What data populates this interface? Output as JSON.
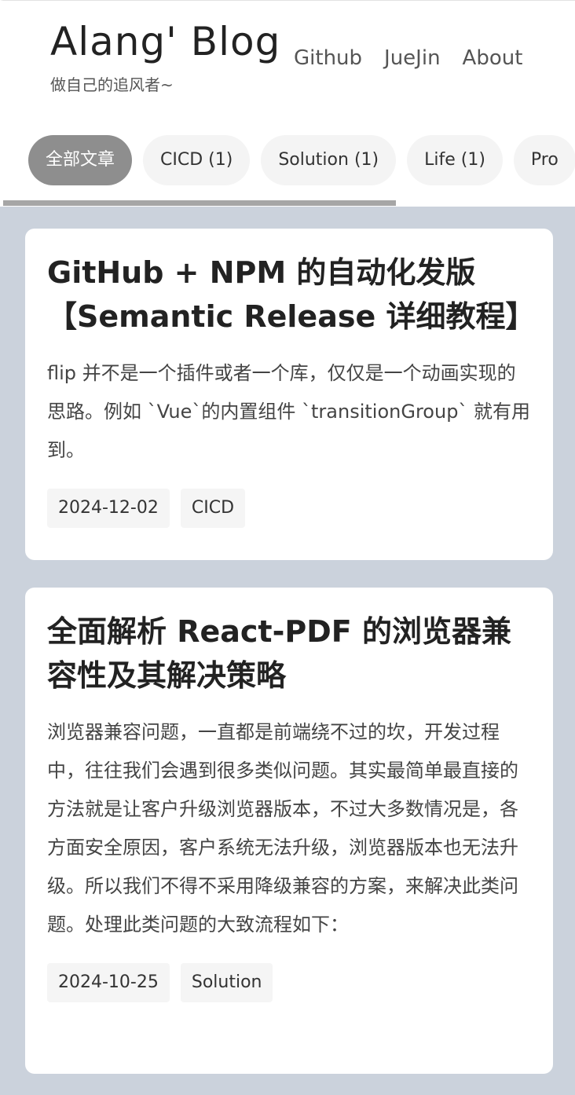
{
  "header": {
    "title": "Alang' Blog",
    "subtitle": "做自己的追风者~",
    "nav": [
      {
        "label": "Github"
      },
      {
        "label": "JueJin"
      },
      {
        "label": "About"
      }
    ]
  },
  "tabs": [
    {
      "label": "全部文章"
    },
    {
      "label": "CICD (1)"
    },
    {
      "label": "Solution (1)"
    },
    {
      "label": "Life (1)"
    },
    {
      "label": "Pro"
    }
  ],
  "posts": [
    {
      "title": "GitHub + NPM 的自动化发版【Semantic Release 详细教程】",
      "excerpt": "flip 并不是一个插件或者一个库，仅仅是一个动画实现的思路。例如 `Vue`的内置组件 `transitionGroup` 就有用到。",
      "date": "2024-12-02",
      "category": "CICD"
    },
    {
      "title": "全面解析 React-PDF 的浏览器兼容性及其解决策略",
      "excerpt": "浏览器兼容问题，一直都是前端绕不过的坎，开发过程中，往往我们会遇到很多类似问题。其实最简单最直接的方法就是让客户升级浏览器版本，不过大多数情况是，各方面安全原因，客户系统无法升级，浏览器版本也无法升级。所以我们不得不采用降级兼容的方案，来解决此类问题。处理此类问题的大致流程如下：",
      "date": "2024-10-25",
      "category": "Solution"
    }
  ]
}
